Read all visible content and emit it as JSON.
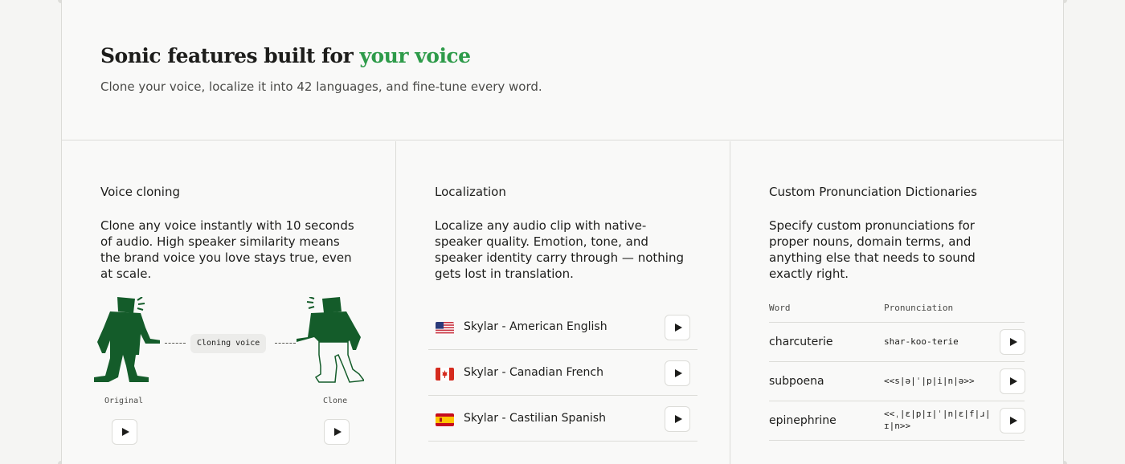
{
  "header": {
    "title_prefix": "Sonic features built for ",
    "title_accent": "your voice",
    "subtitle": "Clone your voice, localize it into 42 languages, and fine-tune every word."
  },
  "voice_cloning": {
    "title": "Voice cloning",
    "description": "Clone any voice instantly with 10 seconds of audio. High speaker similarity means the brand voice you love stays true, even at scale.",
    "pill_label": "Cloning voice",
    "original_label": "Original",
    "clone_label": "Clone"
  },
  "localization": {
    "title": "Localization",
    "description": "Localize any audio clip with native-speaker quality. Emotion, tone, and speaker identity carry through — nothing gets lost in translation.",
    "items": [
      {
        "label": "Skylar - American English",
        "flag": "us-flag"
      },
      {
        "label": "Skylar - Canadian French",
        "flag": "ca-flag"
      },
      {
        "label": "Skylar - Castilian Spanish",
        "flag": "es-flag"
      }
    ]
  },
  "dictionaries": {
    "title": "Custom Pronunciation Dictionaries",
    "description": "Specify custom pronunciations for proper nouns, domain terms, and anything else that needs to sound exactly right.",
    "col_word": "Word",
    "col_pron": "Pronunciation",
    "rows": [
      {
        "word": "charcuterie",
        "pron": "shar-koo-terie"
      },
      {
        "word": "subpoena",
        "pron": "<<s|ə|ˈ|p|i|n|ə>>"
      },
      {
        "word": "epinephrine",
        "pron": "<<ˌ|ɛ|p|ɪ|ˈ|n|ɛ|f|ɹ|ɪ|n>>"
      }
    ]
  },
  "colors": {
    "accent": "#2e9b4a",
    "figure_green": "#145c2a",
    "text": "#1d1d1b",
    "border": "#dcdcd8"
  }
}
